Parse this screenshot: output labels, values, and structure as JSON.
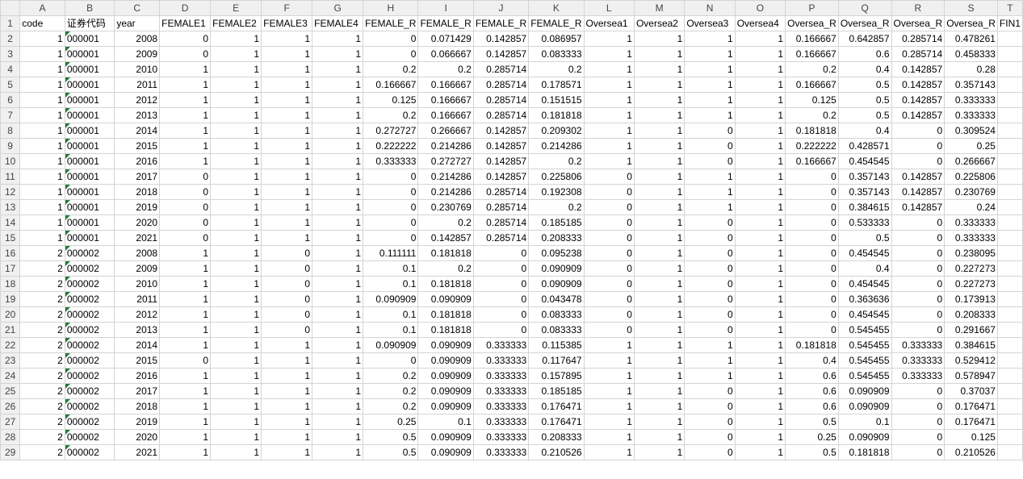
{
  "columns": [
    "A",
    "B",
    "C",
    "D",
    "E",
    "F",
    "G",
    "H",
    "I",
    "J",
    "K",
    "L",
    "M",
    "N",
    "O",
    "P",
    "Q",
    "R",
    "S",
    "T"
  ],
  "header": [
    "code",
    "证券代码",
    "year",
    "FEMALE1",
    "FEMALE2",
    "FEMALE3",
    "FEMALE4",
    "FEMALE_R",
    "FEMALE_R",
    "FEMALE_R",
    "FEMALE_R",
    "Oversea1",
    "Oversea2",
    "Oversea3",
    "Oversea4",
    "Oversea_R",
    "Oversea_R",
    "Oversea_R",
    "Oversea_R",
    "FIN1"
  ],
  "text_flag_color": "#1e7b3a",
  "rows": [
    [
      "1",
      "000001",
      "2008",
      "0",
      "1",
      "1",
      "1",
      "0",
      "0.071429",
      "0.142857",
      "0.086957",
      "1",
      "1",
      "1",
      "1",
      "0.166667",
      "0.642857",
      "0.285714",
      "0.478261"
    ],
    [
      "1",
      "000001",
      "2009",
      "0",
      "1",
      "1",
      "1",
      "0",
      "0.066667",
      "0.142857",
      "0.083333",
      "1",
      "1",
      "1",
      "1",
      "0.166667",
      "0.6",
      "0.285714",
      "0.458333"
    ],
    [
      "1",
      "000001",
      "2010",
      "1",
      "1",
      "1",
      "1",
      "0.2",
      "0.2",
      "0.285714",
      "0.2",
      "1",
      "1",
      "1",
      "1",
      "0.2",
      "0.4",
      "0.142857",
      "0.28"
    ],
    [
      "1",
      "000001",
      "2011",
      "1",
      "1",
      "1",
      "1",
      "0.166667",
      "0.166667",
      "0.285714",
      "0.178571",
      "1",
      "1",
      "1",
      "1",
      "0.166667",
      "0.5",
      "0.142857",
      "0.357143"
    ],
    [
      "1",
      "000001",
      "2012",
      "1",
      "1",
      "1",
      "1",
      "0.125",
      "0.166667",
      "0.285714",
      "0.151515",
      "1",
      "1",
      "1",
      "1",
      "0.125",
      "0.5",
      "0.142857",
      "0.333333"
    ],
    [
      "1",
      "000001",
      "2013",
      "1",
      "1",
      "1",
      "1",
      "0.2",
      "0.166667",
      "0.285714",
      "0.181818",
      "1",
      "1",
      "1",
      "1",
      "0.2",
      "0.5",
      "0.142857",
      "0.333333"
    ],
    [
      "1",
      "000001",
      "2014",
      "1",
      "1",
      "1",
      "1",
      "0.272727",
      "0.266667",
      "0.142857",
      "0.209302",
      "1",
      "1",
      "0",
      "1",
      "0.181818",
      "0.4",
      "0",
      "0.309524"
    ],
    [
      "1",
      "000001",
      "2015",
      "1",
      "1",
      "1",
      "1",
      "0.222222",
      "0.214286",
      "0.142857",
      "0.214286",
      "1",
      "1",
      "0",
      "1",
      "0.222222",
      "0.428571",
      "0",
      "0.25"
    ],
    [
      "1",
      "000001",
      "2016",
      "1",
      "1",
      "1",
      "1",
      "0.333333",
      "0.272727",
      "0.142857",
      "0.2",
      "1",
      "1",
      "0",
      "1",
      "0.166667",
      "0.454545",
      "0",
      "0.266667"
    ],
    [
      "1",
      "000001",
      "2017",
      "0",
      "1",
      "1",
      "1",
      "0",
      "0.214286",
      "0.142857",
      "0.225806",
      "0",
      "1",
      "1",
      "1",
      "0",
      "0.357143",
      "0.142857",
      "0.225806"
    ],
    [
      "1",
      "000001",
      "2018",
      "0",
      "1",
      "1",
      "1",
      "0",
      "0.214286",
      "0.285714",
      "0.192308",
      "0",
      "1",
      "1",
      "1",
      "0",
      "0.357143",
      "0.142857",
      "0.230769"
    ],
    [
      "1",
      "000001",
      "2019",
      "0",
      "1",
      "1",
      "1",
      "0",
      "0.230769",
      "0.285714",
      "0.2",
      "0",
      "1",
      "1",
      "1",
      "0",
      "0.384615",
      "0.142857",
      "0.24"
    ],
    [
      "1",
      "000001",
      "2020",
      "0",
      "1",
      "1",
      "1",
      "0",
      "0.2",
      "0.285714",
      "0.185185",
      "0",
      "1",
      "0",
      "1",
      "0",
      "0.533333",
      "0",
      "0.333333"
    ],
    [
      "1",
      "000001",
      "2021",
      "0",
      "1",
      "1",
      "1",
      "0",
      "0.142857",
      "0.285714",
      "0.208333",
      "0",
      "1",
      "0",
      "1",
      "0",
      "0.5",
      "0",
      "0.333333"
    ],
    [
      "2",
      "000002",
      "2008",
      "1",
      "1",
      "0",
      "1",
      "0.111111",
      "0.181818",
      "0",
      "0.095238",
      "0",
      "1",
      "0",
      "1",
      "0",
      "0.454545",
      "0",
      "0.238095"
    ],
    [
      "2",
      "000002",
      "2009",
      "1",
      "1",
      "0",
      "1",
      "0.1",
      "0.2",
      "0",
      "0.090909",
      "0",
      "1",
      "0",
      "1",
      "0",
      "0.4",
      "0",
      "0.227273"
    ],
    [
      "2",
      "000002",
      "2010",
      "1",
      "1",
      "0",
      "1",
      "0.1",
      "0.181818",
      "0",
      "0.090909",
      "0",
      "1",
      "0",
      "1",
      "0",
      "0.454545",
      "0",
      "0.227273"
    ],
    [
      "2",
      "000002",
      "2011",
      "1",
      "1",
      "0",
      "1",
      "0.090909",
      "0.090909",
      "0",
      "0.043478",
      "0",
      "1",
      "0",
      "1",
      "0",
      "0.363636",
      "0",
      "0.173913"
    ],
    [
      "2",
      "000002",
      "2012",
      "1",
      "1",
      "0",
      "1",
      "0.1",
      "0.181818",
      "0",
      "0.083333",
      "0",
      "1",
      "0",
      "1",
      "0",
      "0.454545",
      "0",
      "0.208333"
    ],
    [
      "2",
      "000002",
      "2013",
      "1",
      "1",
      "0",
      "1",
      "0.1",
      "0.181818",
      "0",
      "0.083333",
      "0",
      "1",
      "0",
      "1",
      "0",
      "0.545455",
      "0",
      "0.291667"
    ],
    [
      "2",
      "000002",
      "2014",
      "1",
      "1",
      "1",
      "1",
      "0.090909",
      "0.090909",
      "0.333333",
      "0.115385",
      "1",
      "1",
      "1",
      "1",
      "0.181818",
      "0.545455",
      "0.333333",
      "0.384615"
    ],
    [
      "2",
      "000002",
      "2015",
      "0",
      "1",
      "1",
      "1",
      "0",
      "0.090909",
      "0.333333",
      "0.117647",
      "1",
      "1",
      "1",
      "1",
      "0.4",
      "0.545455",
      "0.333333",
      "0.529412"
    ],
    [
      "2",
      "000002",
      "2016",
      "1",
      "1",
      "1",
      "1",
      "0.2",
      "0.090909",
      "0.333333",
      "0.157895",
      "1",
      "1",
      "1",
      "1",
      "0.6",
      "0.545455",
      "0.333333",
      "0.578947"
    ],
    [
      "2",
      "000002",
      "2017",
      "1",
      "1",
      "1",
      "1",
      "0.2",
      "0.090909",
      "0.333333",
      "0.185185",
      "1",
      "1",
      "0",
      "1",
      "0.6",
      "0.090909",
      "0",
      "0.37037"
    ],
    [
      "2",
      "000002",
      "2018",
      "1",
      "1",
      "1",
      "1",
      "0.2",
      "0.090909",
      "0.333333",
      "0.176471",
      "1",
      "1",
      "0",
      "1",
      "0.6",
      "0.090909",
      "0",
      "0.176471"
    ],
    [
      "2",
      "000002",
      "2019",
      "1",
      "1",
      "1",
      "1",
      "0.25",
      "0.1",
      "0.333333",
      "0.176471",
      "1",
      "1",
      "0",
      "1",
      "0.5",
      "0.1",
      "0",
      "0.176471"
    ],
    [
      "2",
      "000002",
      "2020",
      "1",
      "1",
      "1",
      "1",
      "0.5",
      "0.090909",
      "0.333333",
      "0.208333",
      "1",
      "1",
      "0",
      "1",
      "0.25",
      "0.090909",
      "0",
      "0.125"
    ],
    [
      "2",
      "000002",
      "2021",
      "1",
      "1",
      "1",
      "1",
      "0.5",
      "0.090909",
      "0.333333",
      "0.210526",
      "1",
      "1",
      "0",
      "1",
      "0.5",
      "0.181818",
      "0",
      "0.210526"
    ]
  ]
}
